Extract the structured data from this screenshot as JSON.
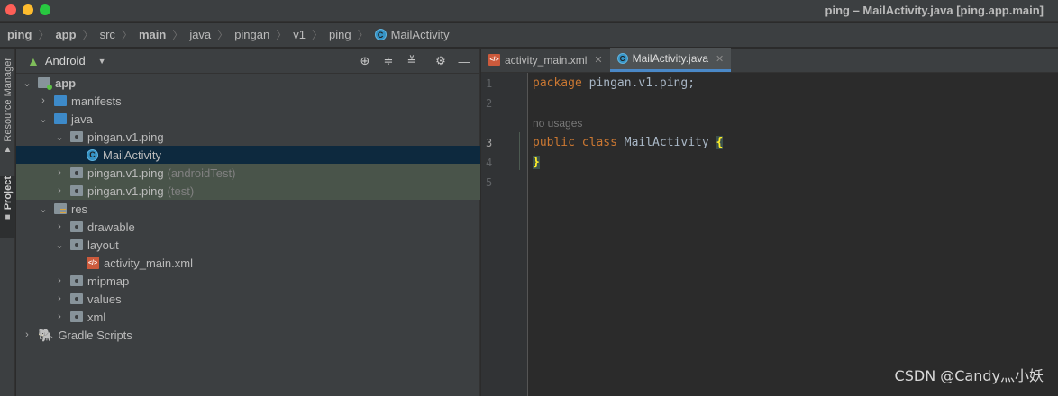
{
  "window": {
    "title": "ping – MailActivity.java [ping.app.main]"
  },
  "breadcrumb": {
    "items": [
      "ping",
      "app",
      "src",
      "main",
      "java",
      "pingan",
      "v1",
      "ping",
      "MailActivity"
    ],
    "separator": "〉"
  },
  "tool_strip": {
    "resource_manager": "Resource Manager",
    "project": "Project"
  },
  "project_panel": {
    "view": "Android",
    "tree": [
      {
        "label": "app",
        "expanded": true,
        "level": 0,
        "icon": "module-folder-icon"
      },
      {
        "label": "manifests",
        "expanded": false,
        "level": 1,
        "icon": "folder-icon"
      },
      {
        "label": "java",
        "expanded": true,
        "level": 1,
        "icon": "source-folder-icon"
      },
      {
        "label": "pingan.v1.ping",
        "expanded": true,
        "level": 2,
        "icon": "package-icon"
      },
      {
        "label": "MailActivity",
        "level": 3,
        "icon": "class-icon",
        "selected": true
      },
      {
        "label": "pingan.v1.ping",
        "suffix": "(androidTest)",
        "expanded": false,
        "level": 2,
        "icon": "package-icon"
      },
      {
        "label": "pingan.v1.ping",
        "suffix": "(test)",
        "expanded": false,
        "level": 2,
        "icon": "package-icon"
      },
      {
        "label": "res",
        "expanded": true,
        "level": 1,
        "icon": "resources-folder-icon"
      },
      {
        "label": "drawable",
        "expanded": false,
        "level": 2,
        "icon": "package-icon"
      },
      {
        "label": "layout",
        "expanded": true,
        "level": 2,
        "icon": "package-icon"
      },
      {
        "label": "activity_main.xml",
        "level": 3,
        "icon": "xml-file-icon"
      },
      {
        "label": "mipmap",
        "expanded": false,
        "level": 2,
        "icon": "package-icon"
      },
      {
        "label": "values",
        "expanded": false,
        "level": 2,
        "icon": "package-icon"
      },
      {
        "label": "xml",
        "expanded": false,
        "level": 2,
        "icon": "package-icon"
      },
      {
        "label": "Gradle Scripts",
        "expanded": false,
        "level": 0,
        "icon": "gradle-icon"
      }
    ]
  },
  "editor": {
    "tabs": [
      {
        "label": "activity_main.xml",
        "active": false
      },
      {
        "label": "MailActivity.java",
        "active": true
      }
    ],
    "line_numbers": [
      "1",
      "2",
      "3",
      "4",
      "5"
    ],
    "inlay_hint": "no usages",
    "code": {
      "line1_kw": "package",
      "line1_rest": " pingan.v1.ping;",
      "line3_kw": "public class",
      "line3_name": " MailActivity ",
      "open_brace": "{",
      "close_brace": "}"
    }
  },
  "watermark": "CSDN @Candy灬小妖",
  "colors": {
    "selection": "#0d293e",
    "test_package_highlight": "#49544a",
    "keyword": "#cc7832",
    "active_tab_underline": "#4a88c7"
  }
}
